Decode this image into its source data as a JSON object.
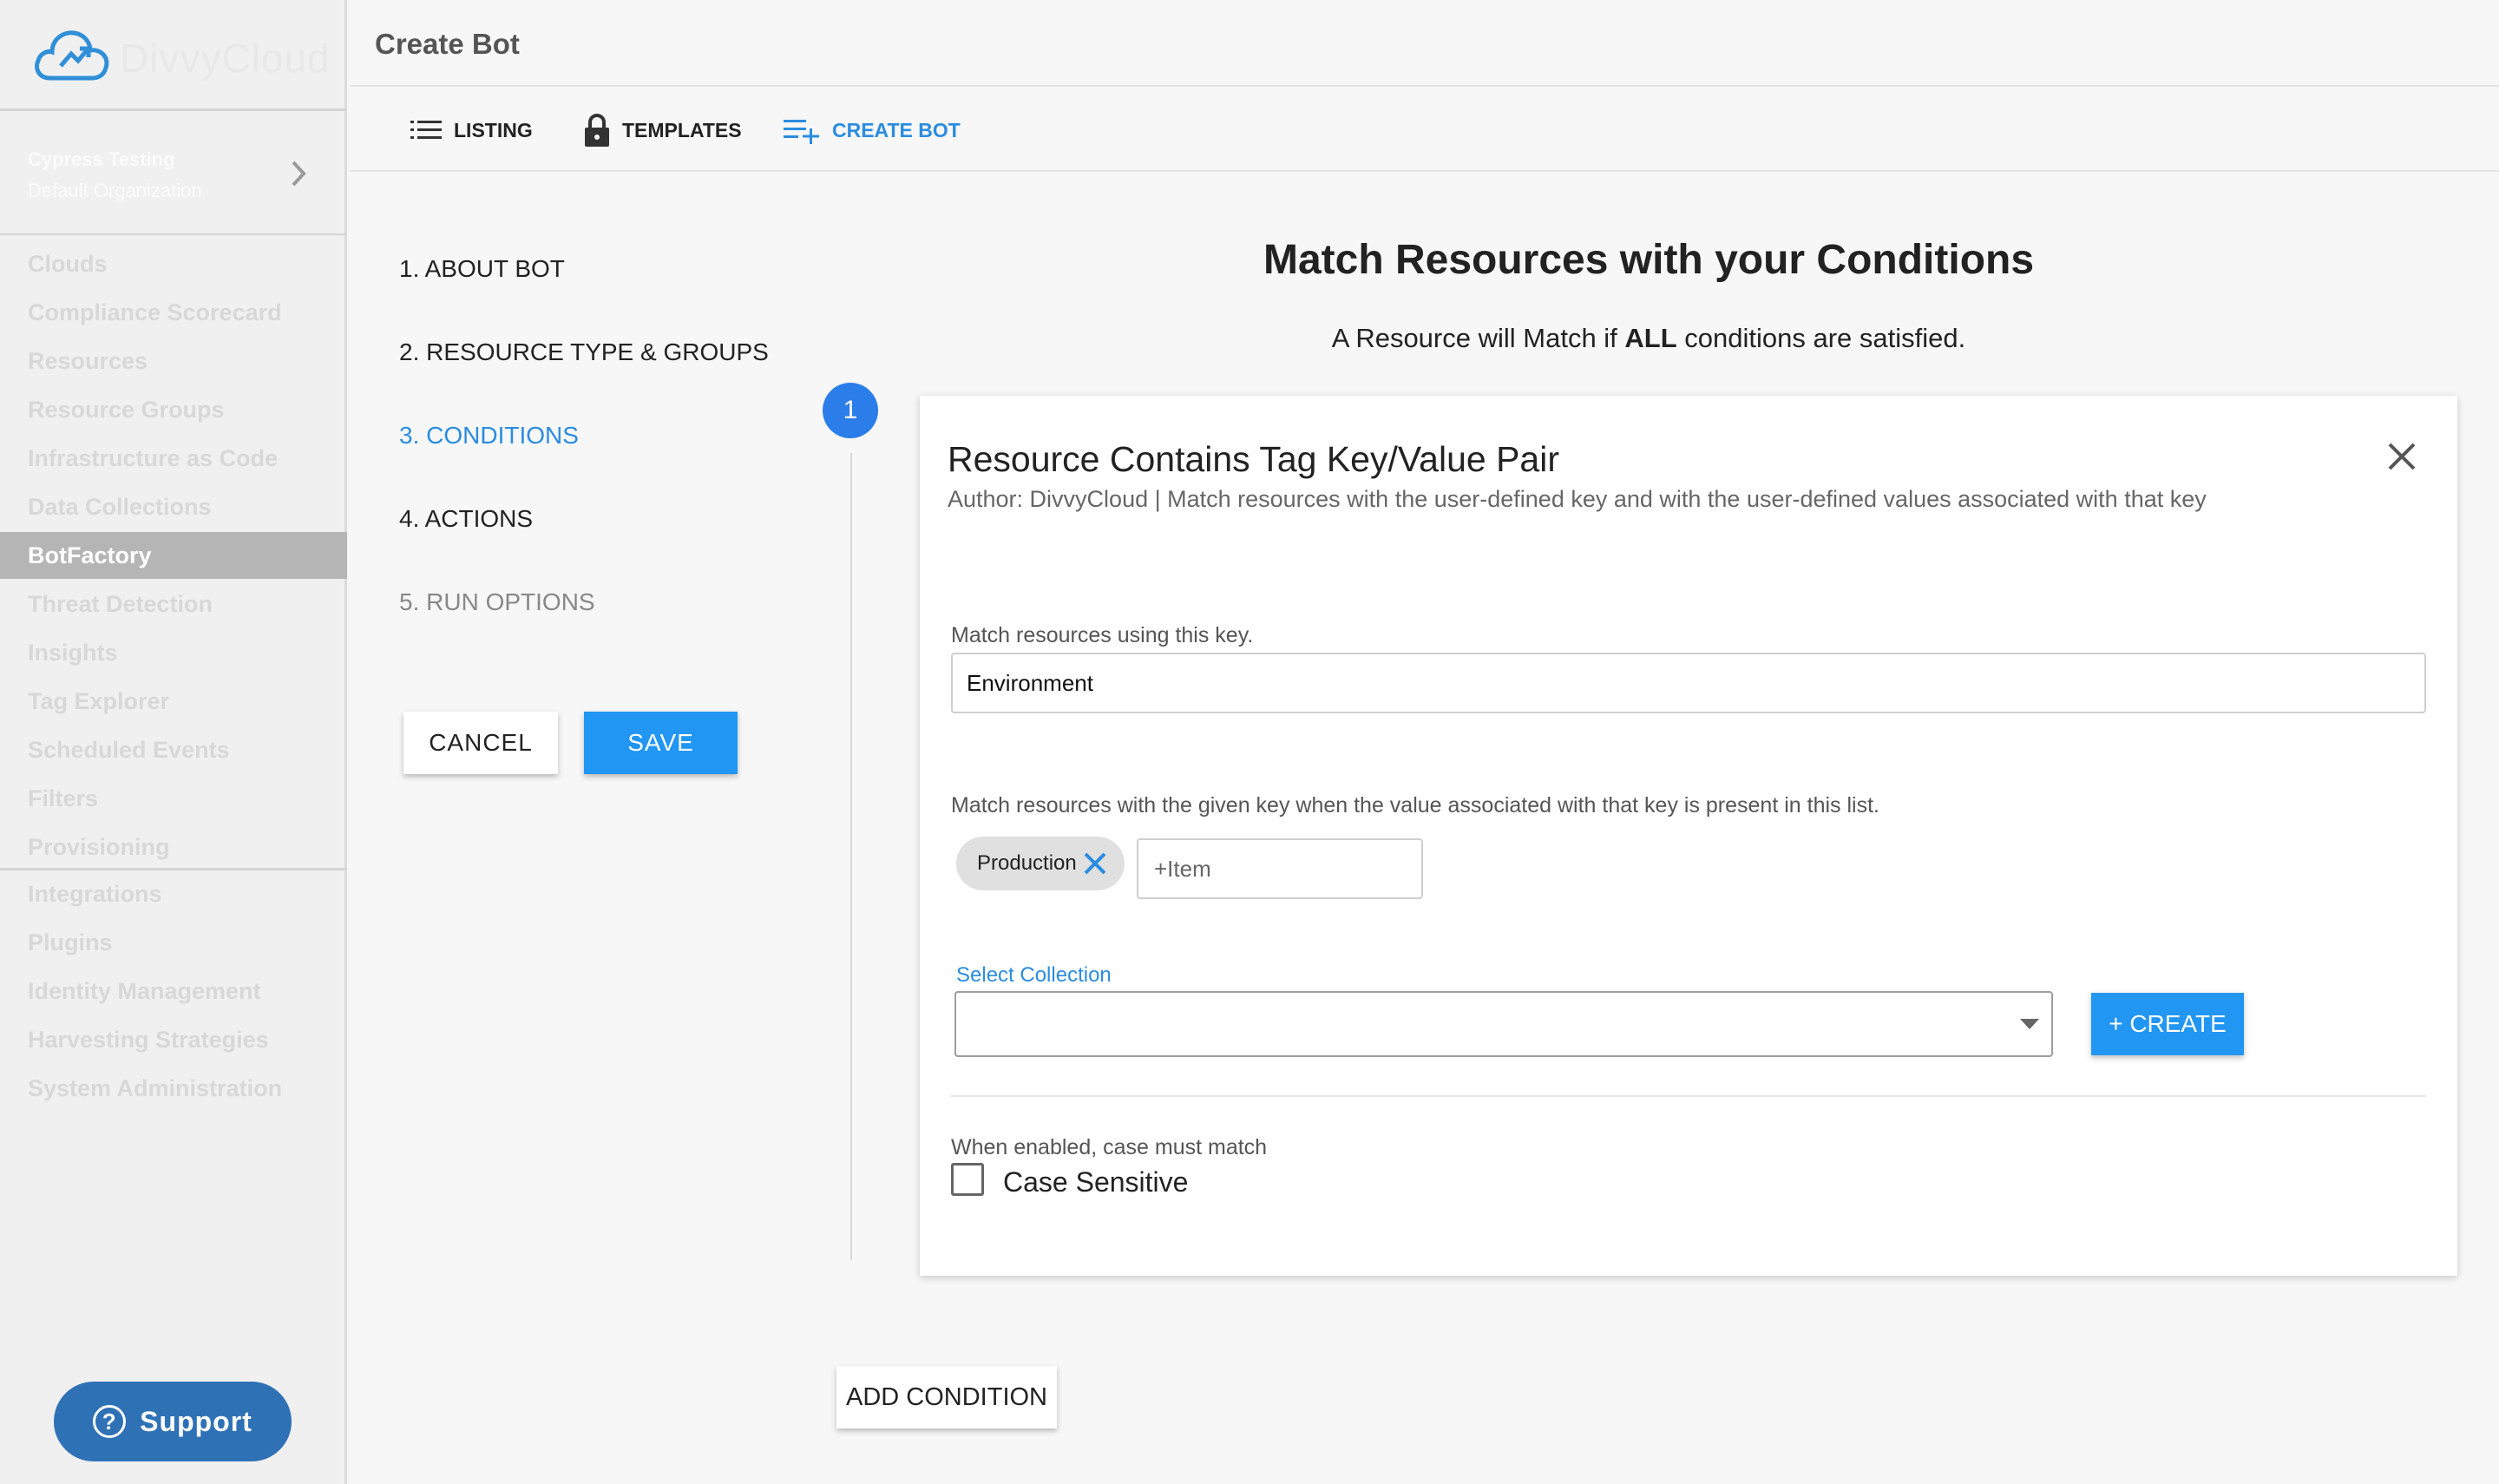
{
  "app": {
    "logo_text": "DivvyCloud"
  },
  "org": {
    "name": "Cypress Testing",
    "sub": "Default Organization"
  },
  "sidebar": {
    "items": [
      {
        "label": "Clouds"
      },
      {
        "label": "Compliance Scorecard"
      },
      {
        "label": "Resources"
      },
      {
        "label": "Resource Groups"
      },
      {
        "label": "Infrastructure as Code"
      },
      {
        "label": "Data Collections"
      },
      {
        "label": "BotFactory",
        "active": true
      },
      {
        "label": "Threat Detection"
      },
      {
        "label": "Insights"
      },
      {
        "label": "Tag Explorer"
      },
      {
        "label": "Scheduled Events"
      },
      {
        "label": "Filters"
      },
      {
        "label": "Provisioning"
      },
      {
        "label": "Integrations"
      },
      {
        "label": "Plugins"
      },
      {
        "label": "Identity Management"
      },
      {
        "label": "Harvesting Strategies"
      },
      {
        "label": "System Administration"
      }
    ],
    "support_label": "Support"
  },
  "header": {
    "title": "Create Bot"
  },
  "tabs": [
    {
      "label": "LISTING",
      "icon": "list-icon"
    },
    {
      "label": "TEMPLATES",
      "icon": "lock-icon"
    },
    {
      "label": "CREATE BOT",
      "icon": "playlist-add-icon",
      "active": true
    }
  ],
  "steps": [
    {
      "label": "1. ABOUT BOT"
    },
    {
      "label": "2. RESOURCE TYPE & GROUPS"
    },
    {
      "label": "3. CONDITIONS",
      "active": true
    },
    {
      "label": "4. ACTIONS"
    },
    {
      "label": "5. RUN OPTIONS",
      "muted": true
    }
  ],
  "actions": {
    "cancel": "CANCEL",
    "save": "SAVE",
    "add_condition": "ADD CONDITION"
  },
  "main": {
    "title": "Match Resources with your Conditions",
    "subtitle_pre": "A Resource will Match if ",
    "subtitle_bold": "ALL",
    "subtitle_post": " conditions are satisfied."
  },
  "condition": {
    "number": "1",
    "title": "Resource Contains Tag Key/Value Pair",
    "author": "Author: DivvyCloud | Match resources with the user-defined key and with the user-defined values associated with that key",
    "key_label": "Match resources using this key.",
    "key_value": "Environment",
    "values_label": "Match resources with the given key when the value associated with that key is present in this list.",
    "chips": [
      "Production"
    ],
    "item_placeholder": "+Item",
    "collection_label": "Select Collection",
    "create_label": "+ CREATE",
    "case_hint": "When enabled, case must match",
    "case_label": "Case Sensitive",
    "case_checked": false
  },
  "colors": {
    "accent": "#2b8ce0",
    "primary_button": "#2196f3",
    "support": "#2f71b5"
  }
}
